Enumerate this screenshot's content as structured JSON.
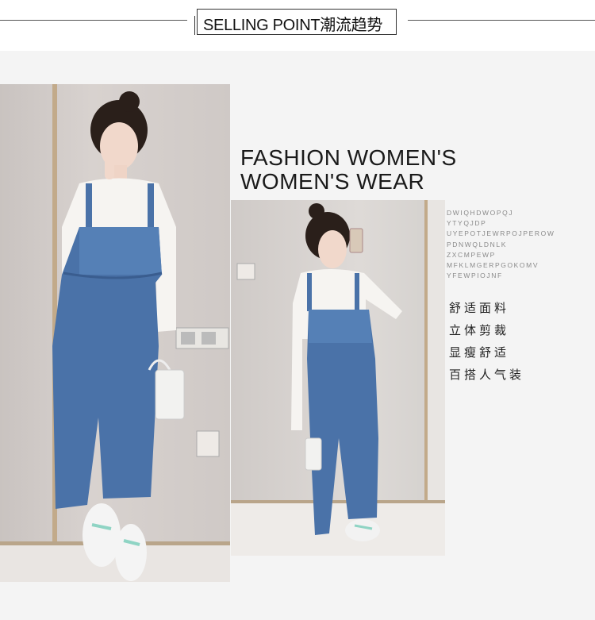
{
  "header": {
    "title": "SELLING POINT潮流趋势"
  },
  "headline": {
    "line1": "FASHION WOMEN'S",
    "line2": "WOMEN'S WEAR"
  },
  "letter_lines": [
    "DWIQHDWOPQJ",
    "YTYQJDP",
    "UYEPOTJEWRPOJPEROW",
    "PDNWQLDNLK",
    "ZXCMPEWP",
    "MFKLMGERPGOKOMV",
    "YFEWPIOJNF"
  ],
  "features": [
    "舒适面料",
    "立体剪裁",
    "显瘦舒适",
    "百搭人气装"
  ],
  "colors": {
    "denim": "#4a72a8",
    "denim_dark": "#3d5f92",
    "top_white": "#f5f3f0",
    "wall": "#d6d0cd",
    "text": "#1a1a1a"
  }
}
